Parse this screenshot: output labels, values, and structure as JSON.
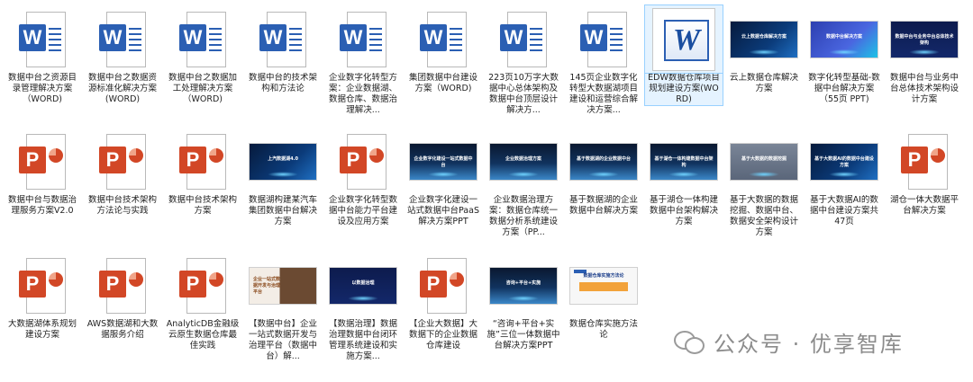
{
  "files": [
    {
      "type": "word",
      "label": "数据中台之资源目录管理解决方案（WORD)"
    },
    {
      "type": "word",
      "label": "数据中台之数据资源标准化解决方案(WORD)"
    },
    {
      "type": "word",
      "label": "数据中台之数据加工处理解决方案（WORD)"
    },
    {
      "type": "word",
      "label": "数据中台的技术架构和方法论"
    },
    {
      "type": "word",
      "label": "企业数字化转型方案：企业数据湖、数据仓库、数据治理解决..."
    },
    {
      "type": "word",
      "label": "集团数据中台建设方案（WORD)"
    },
    {
      "type": "word",
      "label": "223页10万字大数据中心总体架构及数据中台顶层设计解决方..."
    },
    {
      "type": "word",
      "label": "145页企业数字化转型大数据湖项目建设和运营综合解决方案..."
    },
    {
      "type": "oldword",
      "label": "EDW数据仓库项目规划建设方案(WORD)",
      "selected": true
    },
    {
      "type": "slide",
      "style": "dark",
      "thumb_text": "云上数据仓库解决方案",
      "label": "云上数据仓库解决方案"
    },
    {
      "type": "slide",
      "style": "blue",
      "thumb_text": "数据中台解决方案",
      "label": "数字化转型基础-数据中台解决方案（55页 PPT)"
    },
    {
      "type": "slide",
      "style": "navy",
      "thumb_text": "数据中台与业务中台总体技术架构",
      "label": "数据中台与业务中台总体技术架构设计方案"
    },
    {
      "type": "ppt",
      "label": "数据中台与数据治理服务方案V2.0"
    },
    {
      "type": "ppt",
      "label": "数据中台技术架构方法论与实践"
    },
    {
      "type": "ppt",
      "label": "数据中台技术架构方案"
    },
    {
      "type": "slide",
      "style": "dark",
      "thumb_text": "上汽数据湖4.0",
      "label": "数据湖构建某汽车集团数据中台解决方案"
    },
    {
      "type": "ppt",
      "label": "企业数字化转型数据中台能力平台建设及应用方案"
    },
    {
      "type": "slide",
      "style": "tech",
      "thumb_text": "企业数字化建设一站式数据中台",
      "label": "企业数字化建设一站式数据中台PaaS解决方案PPT"
    },
    {
      "type": "slide",
      "style": "tech",
      "thumb_text": "企业数据治理方案",
      "label": "企业数据治理方案：数据仓库统一数据分析系统建设方案（PP..."
    },
    {
      "type": "slide",
      "style": "tech",
      "thumb_text": "基于数据湖的企业数据中台",
      "label": "基于数据湖的企业数据中台解决方案"
    },
    {
      "type": "slide",
      "style": "tech",
      "thumb_text": "基于湖仓一体构建数据中台架构",
      "label": "基于湖仓一体构建数据中台架构解决方案"
    },
    {
      "type": "slide",
      "style": "gray",
      "thumb_text": "基于大数据的数据挖掘",
      "label": "基于大数据的数据挖掘、数据中台、数据安全架构设计方案"
    },
    {
      "type": "slide",
      "style": "dark",
      "thumb_text": "基于大数据AI的数据中台建设方案",
      "label": "基于大数据AI的数据中台建设方案共47页"
    },
    {
      "type": "ppt",
      "label": "湖仓一体大数据平台解决方案"
    },
    {
      "type": "ppt",
      "label": "大数据湖体系规划建设方案"
    },
    {
      "type": "ppt",
      "label": "AWS数据湖和大数据服务介绍"
    },
    {
      "type": "ppt",
      "label": "AnalyticDB金融级云原生数据仓库最佳实践"
    },
    {
      "type": "slide",
      "style": "photo",
      "thumb_text": "企业一站式数据开发与治理平台",
      "label": "【数据中台】企业一站式数据开发与治理平台（数据中台）解..."
    },
    {
      "type": "slide",
      "style": "navy",
      "thumb_text": "以数据治理",
      "label": "【数据治理】数据治理数据中台闭环管理系统建设和实施方案..."
    },
    {
      "type": "ppt",
      "label": "【企业大数据】大数据下的企业数据仓库建设"
    },
    {
      "type": "slide",
      "style": "tech",
      "thumb_text": "咨询+平台+实施",
      "label": "“咨询+平台+实施”三位一体数据中台解决方案PPT"
    },
    {
      "type": "slide",
      "style": "light",
      "thumb_text": "数据仓库实施方法论",
      "label": "数据仓库实施方法论"
    }
  ],
  "watermark": {
    "text": "公众号 · 优享智库"
  }
}
